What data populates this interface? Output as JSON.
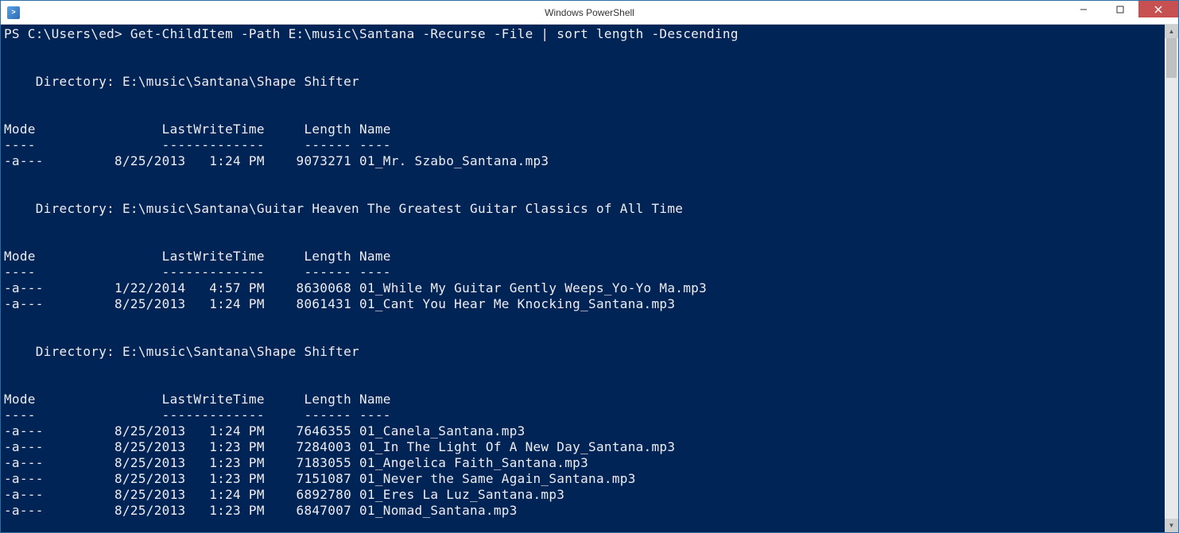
{
  "window": {
    "title": "Windows PowerShell"
  },
  "terminal": {
    "prompt": "PS C:\\Users\\ed> ",
    "command": "Get-ChildItem -Path E:\\music\\Santana -Recurse -File | sort length -Descending",
    "blocks": [
      {
        "directory": "    Directory: E:\\music\\Santana\\Shape Shifter",
        "header": "Mode                LastWriteTime     Length Name",
        "divider": "----                -------------     ------ ----",
        "rows": [
          "-a---         8/25/2013   1:24 PM    9073271 01_Mr. Szabo_Santana.mp3"
        ]
      },
      {
        "directory": "    Directory: E:\\music\\Santana\\Guitar Heaven The Greatest Guitar Classics of All Time",
        "header": "Mode                LastWriteTime     Length Name",
        "divider": "----                -------------     ------ ----",
        "rows": [
          "-a---         1/22/2014   4:57 PM    8630068 01_While My Guitar Gently Weeps_Yo-Yo Ma.mp3",
          "-a---         8/25/2013   1:24 PM    8061431 01_Cant You Hear Me Knocking_Santana.mp3"
        ]
      },
      {
        "directory": "    Directory: E:\\music\\Santana\\Shape Shifter",
        "header": "Mode                LastWriteTime     Length Name",
        "divider": "----                -------------     ------ ----",
        "rows": [
          "-a---         8/25/2013   1:24 PM    7646355 01_Canela_Santana.mp3",
          "-a---         8/25/2013   1:23 PM    7284003 01_In The Light Of A New Day_Santana.mp3",
          "-a---         8/25/2013   1:23 PM    7183055 01_Angelica Faith_Santana.mp3",
          "-a---         8/25/2013   1:23 PM    7151087 01_Never the Same Again_Santana.mp3",
          "-a---         8/25/2013   1:24 PM    6892780 01_Eres La Luz_Santana.mp3",
          "-a---         8/25/2013   1:23 PM    6847007 01_Nomad_Santana.mp3"
        ]
      }
    ]
  }
}
